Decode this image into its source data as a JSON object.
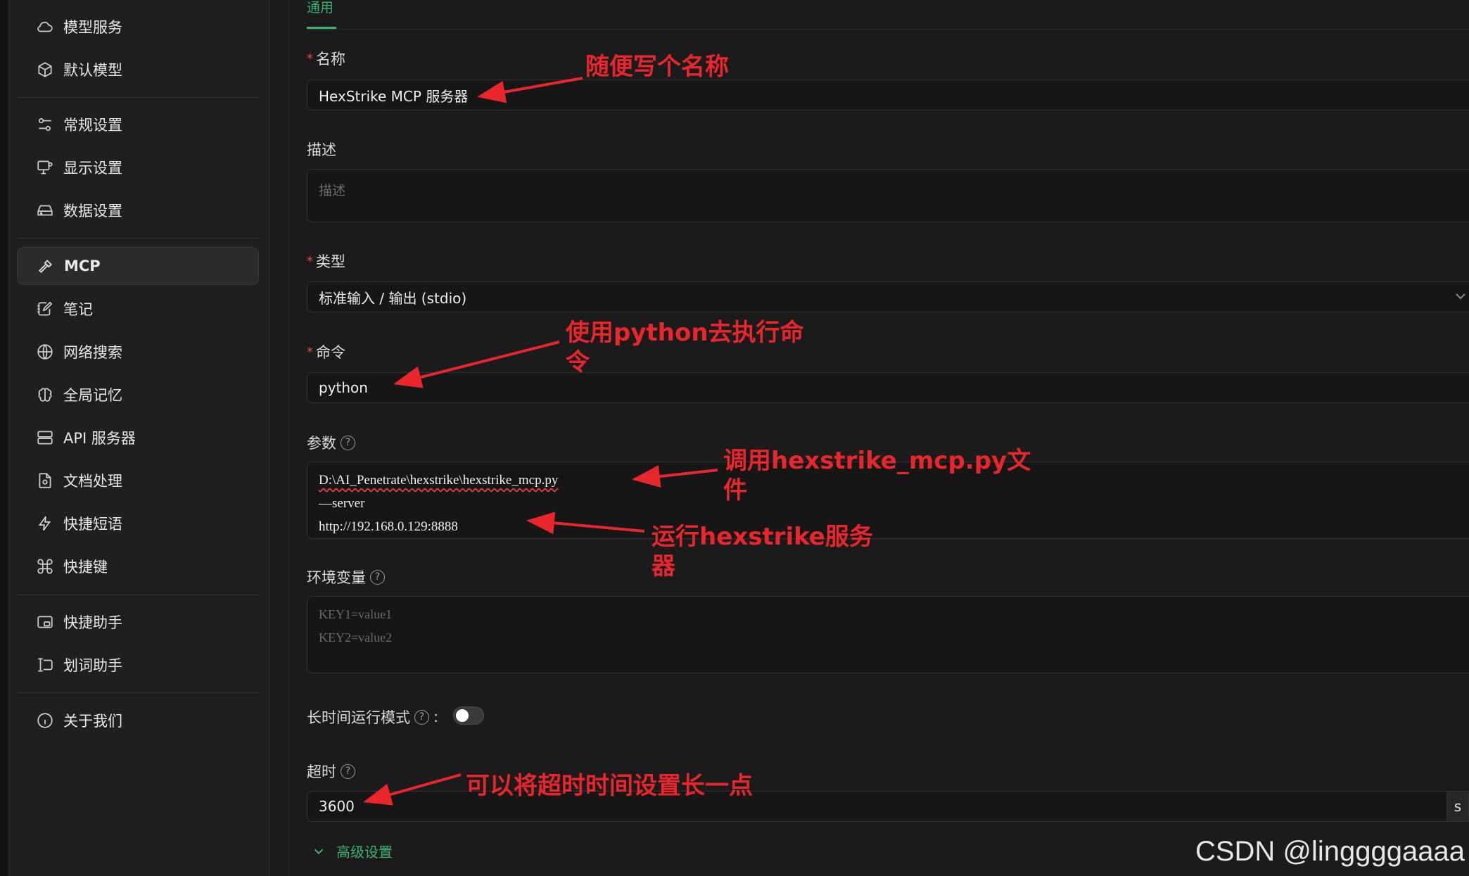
{
  "sidebar": {
    "items": [
      {
        "label": "模型服务",
        "icon": "cloud-icon"
      },
      {
        "label": "默认模型",
        "icon": "cube-icon"
      },
      {
        "label": "常规设置",
        "icon": "sliders-icon"
      },
      {
        "label": "显示设置",
        "icon": "monitor-settings-icon"
      },
      {
        "label": "数据设置",
        "icon": "hard-drive-icon"
      },
      {
        "label": "MCP",
        "icon": "hammer-icon"
      },
      {
        "label": "笔记",
        "icon": "notebook-pen-icon"
      },
      {
        "label": "网络搜索",
        "icon": "globe-icon"
      },
      {
        "label": "全局记忆",
        "icon": "brain-icon"
      },
      {
        "label": "API 服务器",
        "icon": "server-icon"
      },
      {
        "label": "文档处理",
        "icon": "file-cog-icon"
      },
      {
        "label": "快捷短语",
        "icon": "zap-icon"
      },
      {
        "label": "快捷键",
        "icon": "command-icon"
      },
      {
        "label": "快捷助手",
        "icon": "app-window-icon"
      },
      {
        "label": "划词助手",
        "icon": "text-cursor-icon"
      },
      {
        "label": "关于我们",
        "icon": "info-icon"
      }
    ],
    "active": "MCP"
  },
  "tabs": {
    "general": "通用"
  },
  "form": {
    "name_label": "名称",
    "name_value": "HexStrike MCP 服务器",
    "desc_label": "描述",
    "desc_placeholder": "描述",
    "type_label": "类型",
    "type_value": "标准输入 / 输出 (stdio)",
    "command_label": "命令",
    "command_value": "python",
    "args_label": "参数",
    "args_lines": [
      "D:\\AI_Penetrate\\hexstrike\\hexstrike_mcp.py",
      "—server",
      "http://192.168.0.129:8888"
    ],
    "env_label": "环境变量",
    "env_placeholder_lines": [
      "KEY1=value1",
      "KEY2=value2"
    ],
    "long_running_label": "长时间运行模式",
    "long_running_colon": ":",
    "long_running_enabled": false,
    "timeout_label": "超时",
    "timeout_value": "3600",
    "timeout_unit": "s",
    "advanced_label": "高级设置",
    "required_mark": "*",
    "help_glyph": "?"
  },
  "annotations": {
    "name_note": "随便写个名称",
    "command_note_line1": "使用python去执行命",
    "command_note_line2": "令",
    "args_note1_line1": "调用hexstrike_mcp.py文",
    "args_note1_line2": "件",
    "args_note2_line1": "运行hexstrike服务",
    "args_note2_line2": "器",
    "timeout_note": "可以将超时时间设置长一点"
  },
  "watermark": "CSDN @linggggaaaa",
  "colors": {
    "accent": "#3cb371",
    "annotation": "#e8262b",
    "required": "#e84a4a"
  }
}
